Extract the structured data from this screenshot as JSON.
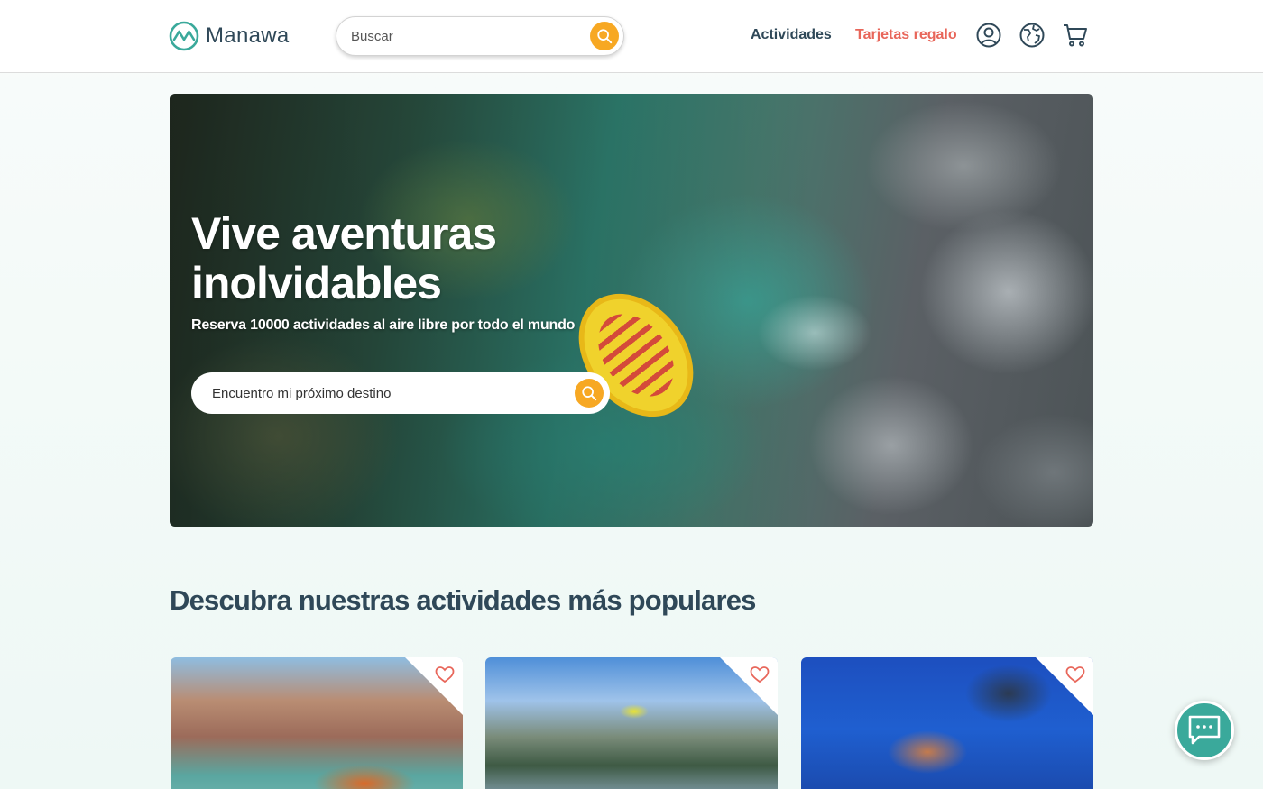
{
  "header": {
    "brand": "Manawa",
    "search_placeholder": "Buscar",
    "nav": {
      "activities": "Actividades",
      "gift_cards": "Tarjetas regalo"
    },
    "icons": [
      "user-icon",
      "globe-icon",
      "cart-icon",
      "search-icon"
    ]
  },
  "hero": {
    "title": "Vive aventuras inolvidables",
    "subtitle": "Reserva 10000 actividades al aire libre por todo el mundo",
    "search_placeholder": "Encuentro mi próximo destino"
  },
  "popular": {
    "title": "Descubra nuestras actividades más populares",
    "cards_count_visible": 3,
    "favorite_icon": "heart-icon"
  },
  "chat": {
    "icon": "chat-bubble-icon"
  },
  "colors": {
    "brand_teal": "#3aa99b",
    "primary_text": "#2f4858",
    "accent_orange": "#f7a823",
    "gift_coral": "#e8665a"
  }
}
